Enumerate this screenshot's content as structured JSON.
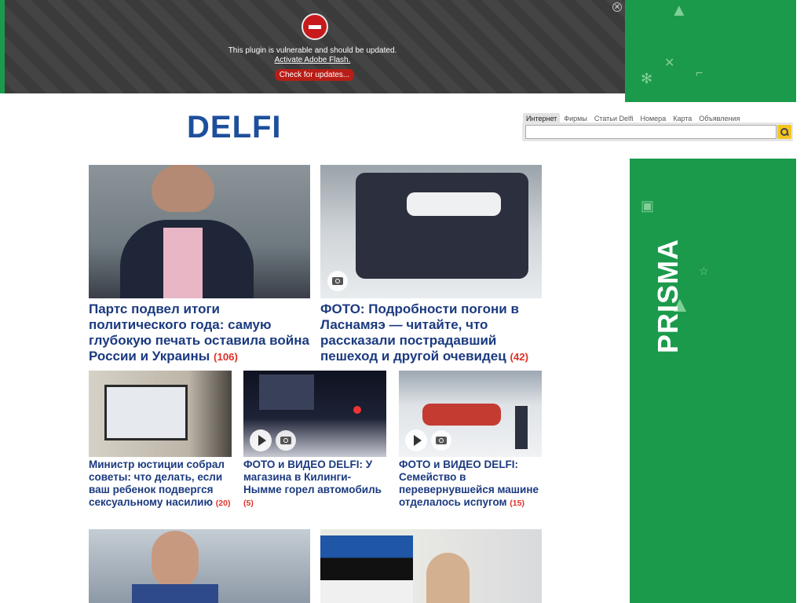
{
  "flash_banner": {
    "message": "This plugin is vulnerable and should be updated.",
    "activate_link": "Activate Adobe Flash.",
    "check_button": "Check for updates...",
    "close_label": "✕"
  },
  "logo": {
    "text": "DELFI"
  },
  "search": {
    "tabs": [
      "Интернет",
      "Фирмы",
      "Статьи Delfi",
      "Номера",
      "Карта",
      "Объявления"
    ],
    "active_tab": "Интернет",
    "query": ""
  },
  "ad": {
    "brand": "PRISMA"
  },
  "articles": [
    {
      "title": "Партс подвел итоги политического года: самую глубокую печать оставила война России и Украины",
      "comments": "(106)"
    },
    {
      "title": "ФОТО: Подробности погони в Ласнамяэ — читайте, что рассказали пострадавший пешеход и другой очевидец",
      "comments": "(42)"
    },
    {
      "title": "Министр юстиции собрал советы: что делать, если ваш ребенок подвергся сексуальному насилию",
      "comments": "(20)"
    },
    {
      "title": "ФОТО и ВИДЕО DELFI: У магазина в Килинги-Нымме горел автомобиль",
      "comments": "(5)"
    },
    {
      "title": "ФОТО и ВИДЕО DELFI: Семейство в перевернувшейся машине отделалось испугом",
      "comments": "(15)"
    }
  ],
  "colors": {
    "headline": "#1b3a80",
    "comment_count": "#e03128",
    "ad_green": "#1c9a4c",
    "flash_button": "#b81d16"
  }
}
